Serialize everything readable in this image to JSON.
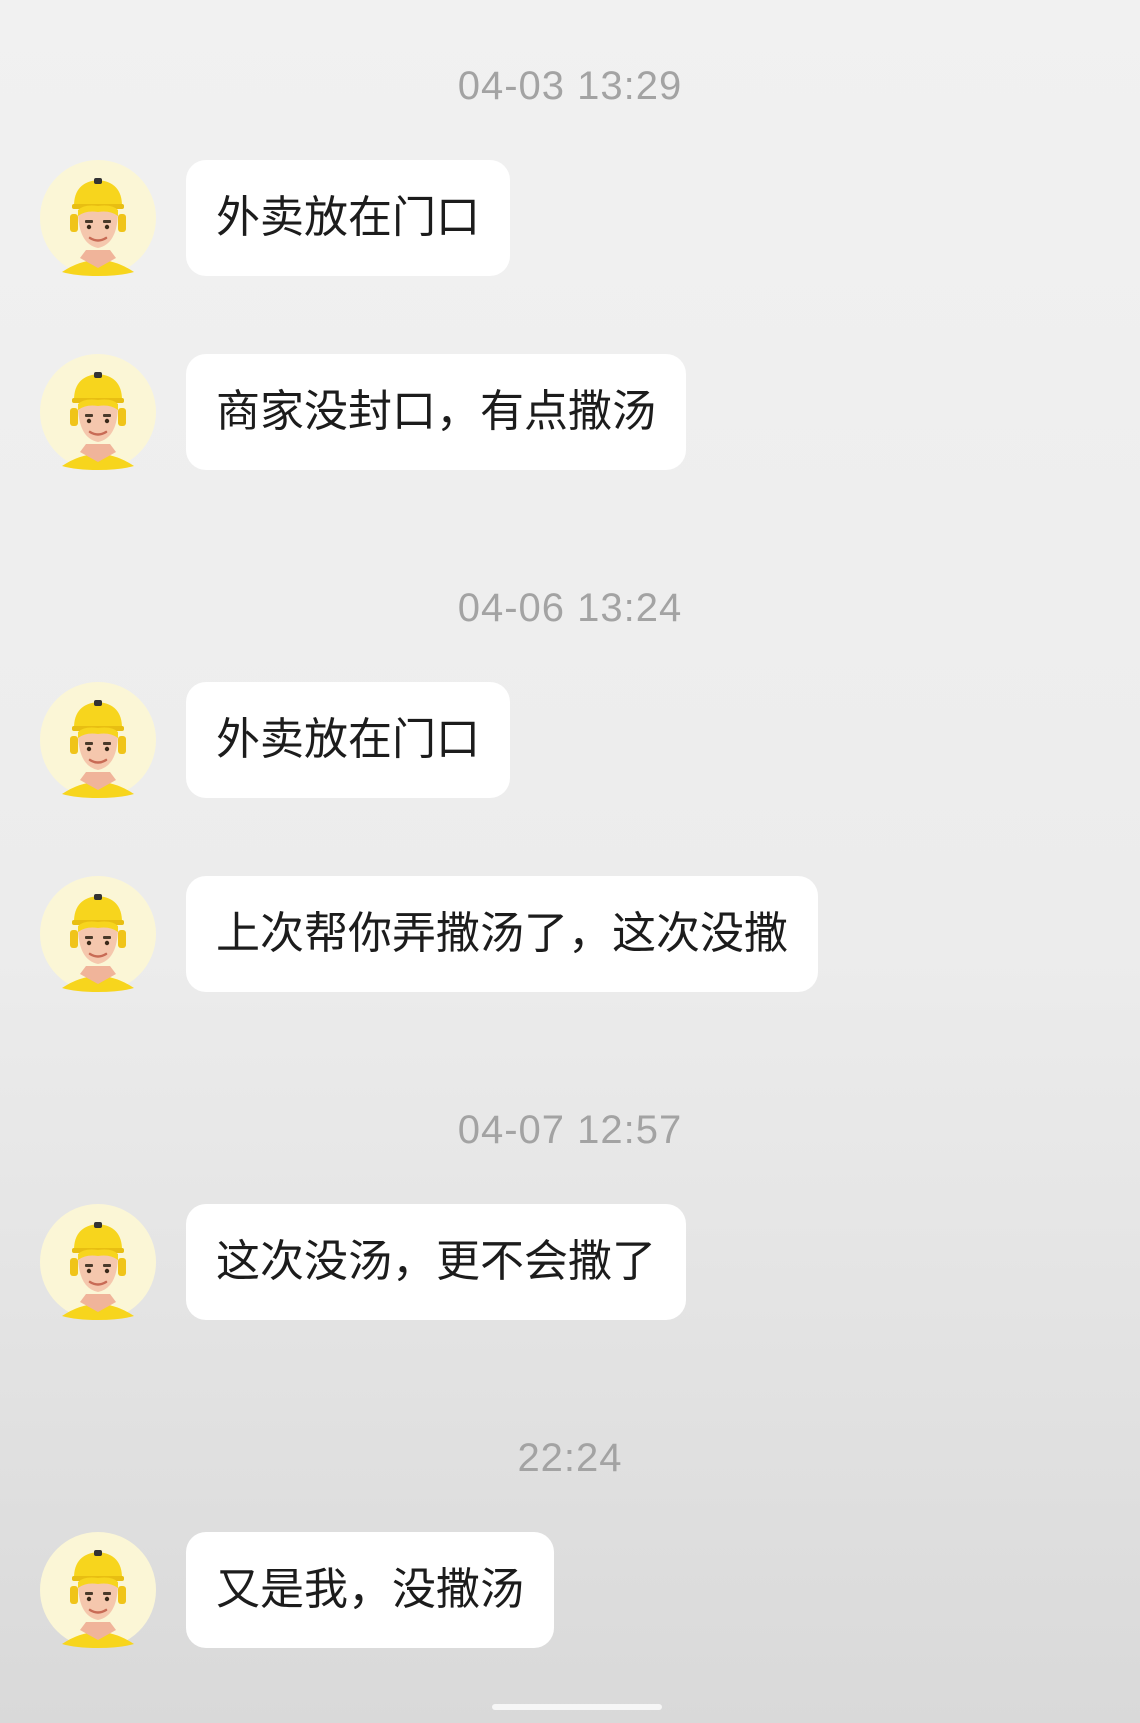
{
  "conversation": [
    {
      "timestamp": "04-03 13:29",
      "messages": [
        {
          "sender": "courier",
          "text": "外卖放在门口"
        },
        {
          "sender": "courier",
          "text": "商家没封口，有点撒汤"
        }
      ]
    },
    {
      "timestamp": "04-06 13:24",
      "messages": [
        {
          "sender": "courier",
          "text": "外卖放在门口"
        },
        {
          "sender": "courier",
          "text": "上次帮你弄撒汤了，这次没撒"
        }
      ]
    },
    {
      "timestamp": "04-07 12:57",
      "messages": [
        {
          "sender": "courier",
          "text": "这次没汤，更不会撒了"
        }
      ]
    },
    {
      "timestamp": "22:24",
      "messages": [
        {
          "sender": "courier",
          "text": "又是我，没撒汤"
        }
      ]
    }
  ],
  "colors": {
    "bubble_background": "#ffffff",
    "timestamp_text": "#a3a3a3",
    "message_text": "#1c1c1c",
    "helmet_yellow": "#f7d51d",
    "avatar_background": "#fbf6d6"
  },
  "icons": {
    "avatar": "courier-avatar-icon"
  }
}
